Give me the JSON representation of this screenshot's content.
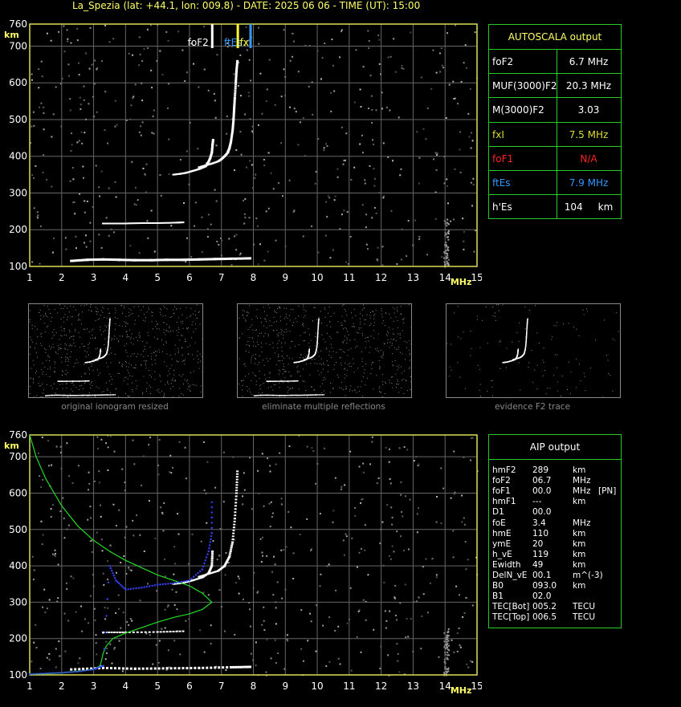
{
  "header": {
    "title": "La_Spezia (lat: +44.1, lon: 009.8) - DATE: 2025 06 06 - TIME (UT): 15:00"
  },
  "chart_data": [
    {
      "type": "scatter",
      "title": "",
      "xlabel": "MHz",
      "ylabel": "km",
      "xlim": [
        1,
        15
      ],
      "ylim": [
        100,
        760
      ],
      "x_ticks": [
        "1",
        "2",
        "3",
        "4",
        "5",
        "6",
        "7",
        "8",
        "9",
        "10",
        "11",
        "12",
        "13",
        "14",
        "15"
      ],
      "y_ticks": [
        "100",
        "200",
        "300",
        "400",
        "500",
        "600",
        "700",
        "760"
      ],
      "grid": true,
      "markers": [
        {
          "label": "foF2",
          "x": 6.7,
          "color": "#ffffff"
        },
        {
          "label": "ftEs",
          "x": 7.9,
          "color": "#3399ff"
        },
        {
          "label": "fx",
          "x": 7.5,
          "color": "#ffff33"
        }
      ],
      "traces": {
        "F2_o": [
          [
            5.5,
            350
          ],
          [
            5.7,
            352
          ],
          [
            5.9,
            355
          ],
          [
            6.1,
            360
          ],
          [
            6.3,
            365
          ],
          [
            6.5,
            372
          ],
          [
            6.6,
            385
          ],
          [
            6.65,
            395
          ],
          [
            6.7,
            410
          ],
          [
            6.72,
            430
          ],
          [
            6.74,
            445
          ]
        ],
        "F2_x": [
          [
            6.3,
            370
          ],
          [
            6.5,
            375
          ],
          [
            6.7,
            380
          ],
          [
            6.9,
            386
          ],
          [
            7.0,
            392
          ],
          [
            7.1,
            400
          ],
          [
            7.2,
            410
          ],
          [
            7.25,
            422
          ],
          [
            7.3,
            440
          ],
          [
            7.35,
            470
          ],
          [
            7.38,
            500
          ],
          [
            7.4,
            530
          ],
          [
            7.42,
            560
          ],
          [
            7.45,
            600
          ],
          [
            7.47,
            630
          ],
          [
            7.5,
            660
          ]
        ],
        "E_layer": [
          [
            3.3,
            217
          ],
          [
            3.6,
            217
          ],
          [
            4.0,
            217
          ],
          [
            4.5,
            218
          ],
          [
            5.0,
            218
          ],
          [
            5.5,
            219
          ],
          [
            5.8,
            220
          ]
        ],
        "Es_layer": [
          [
            2.3,
            115
          ],
          [
            2.8,
            118
          ],
          [
            3.3,
            119
          ],
          [
            3.8,
            118
          ],
          [
            4.3,
            117
          ],
          [
            4.8,
            117
          ],
          [
            5.3,
            118
          ],
          [
            5.8,
            118
          ],
          [
            6.3,
            119
          ],
          [
            6.8,
            120
          ],
          [
            7.3,
            121
          ],
          [
            7.9,
            122
          ]
        ]
      }
    },
    {
      "type": "line",
      "title": "",
      "xlabel": "MHz",
      "ylabel": "km",
      "xlim": [
        1,
        15
      ],
      "ylim": [
        100,
        760
      ],
      "x_ticks": [
        "1",
        "2",
        "3",
        "4",
        "5",
        "6",
        "7",
        "8",
        "9",
        "10",
        "11",
        "12",
        "13",
        "14",
        "15"
      ],
      "y_ticks": [
        "100",
        "200",
        "300",
        "400",
        "500",
        "600",
        "700",
        "760"
      ],
      "grid": true,
      "series": [
        {
          "color": "#22dd22",
          "points": [
            [
              1.0,
              760
            ],
            [
              1.2,
              700
            ],
            [
              1.5,
              640
            ],
            [
              2.0,
              565
            ],
            [
              2.5,
              510
            ],
            [
              3.0,
              470
            ],
            [
              3.5,
              440
            ],
            [
              4.0,
              415
            ],
            [
              4.5,
              395
            ],
            [
              5.0,
              375
            ],
            [
              5.5,
              360
            ],
            [
              6.0,
              345
            ],
            [
              6.4,
              325
            ],
            [
              6.7,
              300
            ],
            [
              6.4,
              280
            ],
            [
              6.0,
              268
            ],
            [
              5.5,
              258
            ],
            [
              5.0,
              245
            ],
            [
              4.5,
              230
            ],
            [
              4.0,
              215
            ],
            [
              3.6,
              200
            ],
            [
              3.4,
              180
            ],
            [
              3.3,
              160
            ],
            [
              3.25,
              140
            ],
            [
              3.2,
              125
            ],
            [
              3.0,
              115
            ],
            [
              2.5,
              110
            ],
            [
              2.0,
              106
            ],
            [
              1.5,
              103
            ],
            [
              1.0,
              102
            ]
          ]
        },
        {
          "color": "#3344ff",
          "points": [
            [
              1.0,
              102
            ],
            [
              1.5,
              104
            ],
            [
              2.0,
              106
            ],
            [
              2.5,
              109
            ],
            [
              3.0,
              115
            ],
            [
              3.3,
              125
            ],
            [
              3.5,
              400
            ],
            [
              3.7,
              360
            ],
            [
              4.0,
              335
            ],
            [
              4.5,
              340
            ],
            [
              5.0,
              348
            ],
            [
              5.5,
              352
            ],
            [
              6.0,
              360
            ],
            [
              6.4,
              390
            ],
            [
              6.6,
              440
            ],
            [
              6.7,
              490
            ],
            [
              6.7,
              575
            ]
          ]
        }
      ],
      "traces": {
        "F2_o": [
          [
            5.5,
            350
          ],
          [
            5.8,
            353
          ],
          [
            6.1,
            360
          ],
          [
            6.4,
            368
          ],
          [
            6.6,
            380
          ],
          [
            6.7,
            400
          ],
          [
            6.72,
            440
          ]
        ],
        "F2_x": [
          [
            6.3,
            370
          ],
          [
            6.6,
            378
          ],
          [
            6.9,
            386
          ],
          [
            7.1,
            400
          ],
          [
            7.25,
            425
          ],
          [
            7.35,
            465
          ],
          [
            7.42,
            530
          ],
          [
            7.47,
            600
          ],
          [
            7.5,
            660
          ]
        ],
        "E_layer": [
          [
            3.3,
            217
          ],
          [
            4.0,
            217
          ],
          [
            5.0,
            218
          ],
          [
            5.8,
            220
          ]
        ],
        "Es_layer": [
          [
            2.3,
            115
          ],
          [
            3.3,
            119
          ],
          [
            4.3,
            117
          ],
          [
            5.3,
            118
          ],
          [
            6.3,
            119
          ],
          [
            7.3,
            121
          ],
          [
            7.9,
            122
          ]
        ]
      }
    }
  ],
  "thumbnails": [
    {
      "caption": "original ionogram resized"
    },
    {
      "caption": "eliminate multiple reflections"
    },
    {
      "caption": "evidence F2 trace"
    }
  ],
  "autoscala": {
    "heading": "AUTOSCALA output",
    "rows": [
      {
        "label": "foF2",
        "value": "6.7 MHz",
        "color": "#ffffff"
      },
      {
        "label": "MUF(3000)F2",
        "value": "20.3 MHz",
        "color": "#ffffff"
      },
      {
        "label": "M(3000)F2",
        "value": "3.03",
        "color": "#ffffff"
      },
      {
        "label": "fxI",
        "value": "7.5 MHz",
        "color": "#dddd33"
      },
      {
        "label": "foF1",
        "value": "N/A",
        "color": "#ff2222"
      },
      {
        "label": "ftEs",
        "value": "7.9 MHz",
        "color": "#3399ff"
      },
      {
        "label": "h'Es",
        "value": "104     km",
        "color": "#ffffff"
      }
    ]
  },
  "aip": {
    "heading": "AIP output",
    "rows": [
      {
        "label": "hmF2",
        "value": "289",
        "unit": "km",
        "extra": ""
      },
      {
        "label": "foF2",
        "value": "06.7",
        "unit": "MHz",
        "extra": ""
      },
      {
        "label": "foF1",
        "value": "00.0",
        "unit": "MHz",
        "extra": "[PN]"
      },
      {
        "label": "hmF1",
        "value": "---",
        "unit": "km",
        "extra": ""
      },
      {
        "label": "D1",
        "value": "00.0",
        "unit": "",
        "extra": ""
      },
      {
        "label": "foE",
        "value": "3.4",
        "unit": "MHz",
        "extra": ""
      },
      {
        "label": "hmE",
        "value": "110",
        "unit": "km",
        "extra": ""
      },
      {
        "label": "ymE",
        "value": "20",
        "unit": "km",
        "extra": ""
      },
      {
        "label": "h_vE",
        "value": "119",
        "unit": "km",
        "extra": ""
      },
      {
        "label": "Ewidth",
        "value": "49",
        "unit": "km",
        "extra": ""
      },
      {
        "label": "DelN_vE",
        "value": "00.1",
        "unit": "m^(-3)",
        "extra": ""
      },
      {
        "label": "B0",
        "value": "093.0",
        "unit": "km",
        "extra": ""
      },
      {
        "label": "B1",
        "value": "02.0",
        "unit": "",
        "extra": ""
      },
      {
        "label": "TEC[Bot]",
        "value": "005.2",
        "unit": "TECU",
        "extra": ""
      },
      {
        "label": "TEC[Top]",
        "value": "006.5",
        "unit": "TECU",
        "extra": ""
      }
    ]
  }
}
